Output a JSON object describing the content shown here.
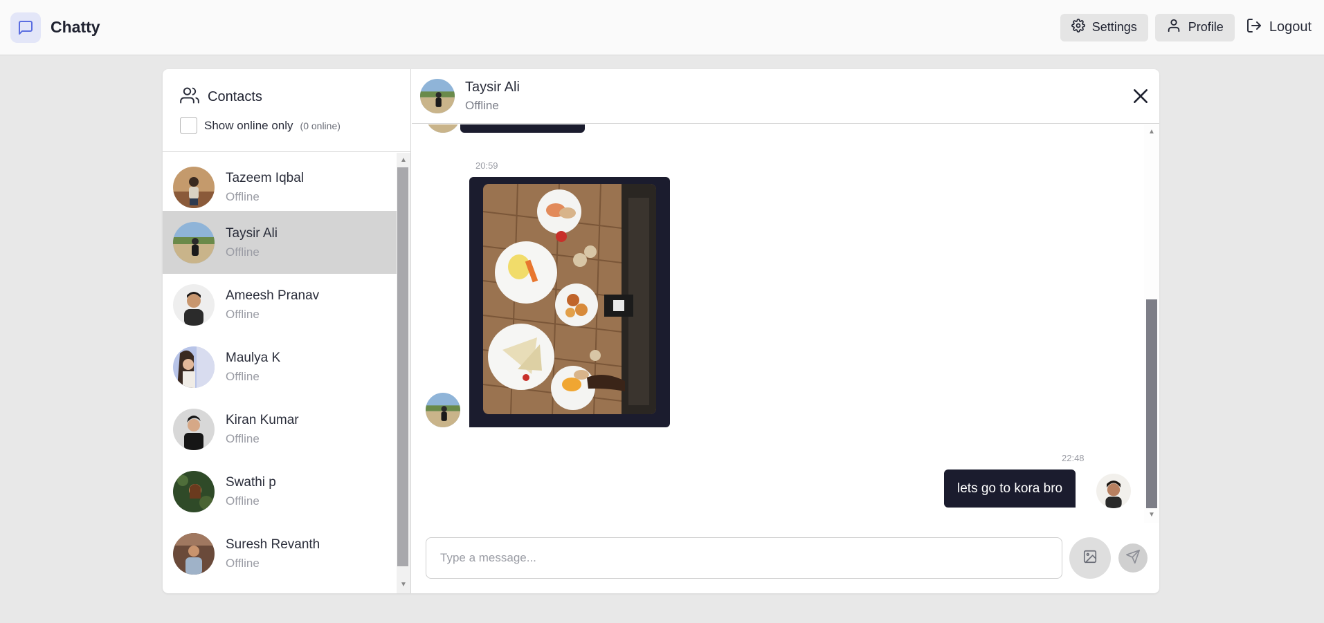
{
  "app": {
    "name": "Chatty",
    "logo_icon": "message-square-icon",
    "accent": "#5b6ee1"
  },
  "nav": {
    "settings_label": "Settings",
    "profile_label": "Profile",
    "logout_label": "Logout"
  },
  "sidebar": {
    "title": "Contacts",
    "filter_label": "Show online only",
    "online_count": "(0 online)",
    "contacts": [
      {
        "name": "Tazeem Iqbal",
        "status": "Offline"
      },
      {
        "name": "Taysir Ali",
        "status": "Offline",
        "active": true
      },
      {
        "name": "Ameesh Pranav",
        "status": "Offline"
      },
      {
        "name": "Maulya K",
        "status": "Offline"
      },
      {
        "name": "Kiran Kumar",
        "status": "Offline"
      },
      {
        "name": "Swathi p",
        "status": "Offline"
      },
      {
        "name": "Suresh Revanth",
        "status": "Offline"
      }
    ]
  },
  "chat": {
    "name": "Taysir Ali",
    "status": "Offline",
    "messages": [
      {
        "time": "20:59",
        "type": "image",
        "from": "contact"
      },
      {
        "time": "22:48",
        "type": "text",
        "from": "me",
        "text": "lets go to kora bro"
      }
    ],
    "input_placeholder": "Type a message..."
  }
}
